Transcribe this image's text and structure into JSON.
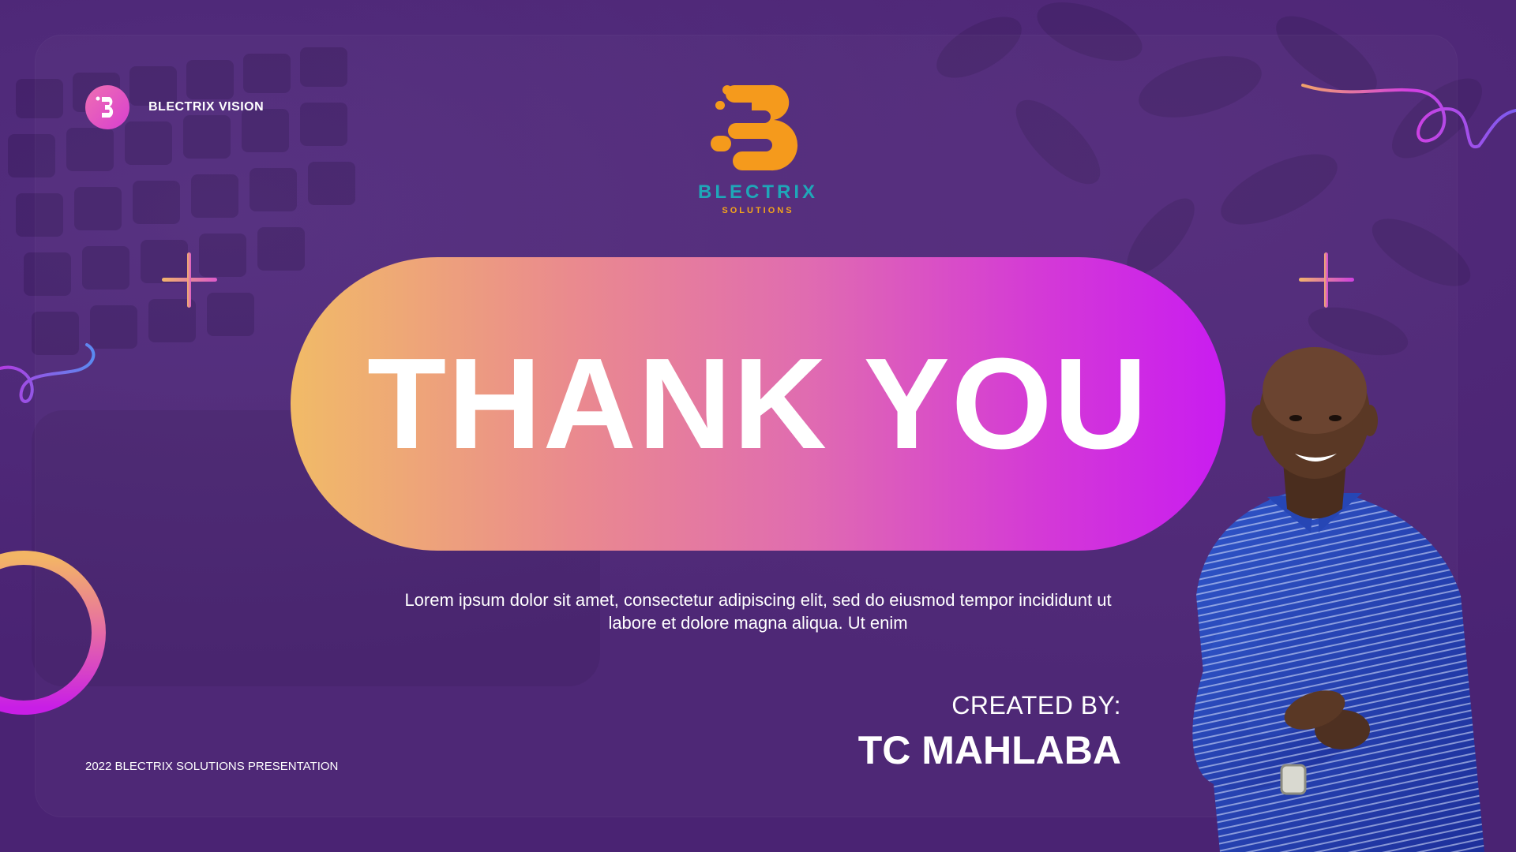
{
  "brand": {
    "name": "BLECTRIX VISION",
    "mark_icon": "b-letter-icon"
  },
  "logo": {
    "wordmark": "BLECTRIX",
    "tagline": "SOLUTIONS",
    "icon": "b-logo-icon"
  },
  "headline": "THANK YOU",
  "description": "Lorem ipsum dolor sit amet, consectetur adipiscing elit, sed do eiusmod tempor incididunt ut labore et dolore magna aliqua. Ut enim",
  "credits": {
    "label": "CREATED BY:",
    "name": "TC MAHLABA"
  },
  "footer": "2022 BLECTRIX SOLUTIONS PRESENTATION",
  "colors": {
    "background": "#4a2373",
    "pill_start": "#f1bb67",
    "pill_end": "#c91cf0",
    "logo_orange": "#f59a1c",
    "logo_teal": "#1fa7b8"
  }
}
